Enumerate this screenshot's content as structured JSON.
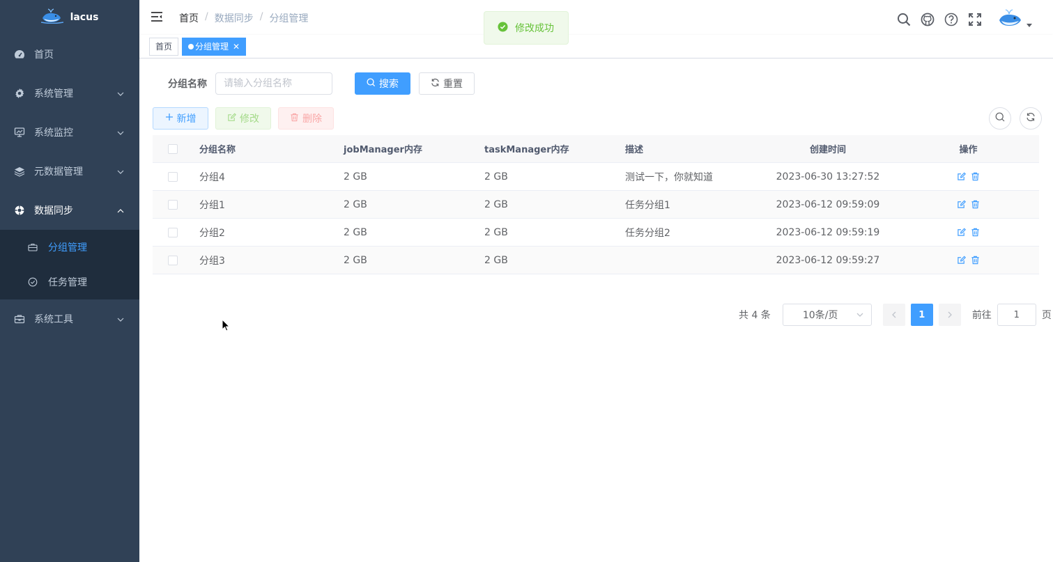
{
  "app": {
    "name": "lacus"
  },
  "sidebar": {
    "items": [
      {
        "label": "首页",
        "icon": "dashboard-icon"
      },
      {
        "label": "系统管理",
        "icon": "gear-icon"
      },
      {
        "label": "系统监控",
        "icon": "monitor-icon"
      },
      {
        "label": "元数据管理",
        "icon": "layers-icon"
      },
      {
        "label": "数据同步",
        "icon": "sync-icon"
      }
    ],
    "sub_items": [
      {
        "label": "分组管理",
        "icon": "briefcase-icon",
        "active": true
      },
      {
        "label": "任务管理",
        "icon": "check-circle-icon"
      }
    ],
    "tools": {
      "label": "系统工具",
      "icon": "toolbox-icon"
    }
  },
  "breadcrumb": [
    "首页",
    "/",
    "数据同步",
    "/",
    "分组管理"
  ],
  "tags": {
    "home": "首页",
    "current": "分组管理"
  },
  "toast": {
    "message": "修改成功"
  },
  "search": {
    "label": "分组名称",
    "placeholder": "请输入分组名称",
    "search_btn": "搜索",
    "reset_btn": "重置"
  },
  "toolbar": {
    "add": "新增",
    "edit": "修改",
    "delete": "删除"
  },
  "table": {
    "headers": {
      "name": "分组名称",
      "jm": "jobManager内存",
      "tm": "taskManager内存",
      "desc": "描述",
      "time": "创建时间",
      "op": "操作"
    },
    "rows": [
      {
        "name": "分组4",
        "jm": "2 GB",
        "tm": "2 GB",
        "desc": "测试一下，你就知道",
        "time": "2023-06-30 13:27:52"
      },
      {
        "name": "分组1",
        "jm": "2 GB",
        "tm": "2 GB",
        "desc": "任务分组1",
        "time": "2023-06-12 09:59:09"
      },
      {
        "name": "分组2",
        "jm": "2 GB",
        "tm": "2 GB",
        "desc": "任务分组2",
        "time": "2023-06-12 09:59:19"
      },
      {
        "name": "分组3",
        "jm": "2 GB",
        "tm": "2 GB",
        "desc": "",
        "time": "2023-06-12 09:59:27"
      }
    ]
  },
  "pagination": {
    "total": "共 4 条",
    "page_size": "10条/页",
    "current": "1",
    "goto_prefix": "前往",
    "goto_value": "1",
    "goto_suffix": "页"
  },
  "colors": {
    "sidebar_bg": "#304156",
    "primary": "#409eff",
    "success": "#67c23a"
  }
}
